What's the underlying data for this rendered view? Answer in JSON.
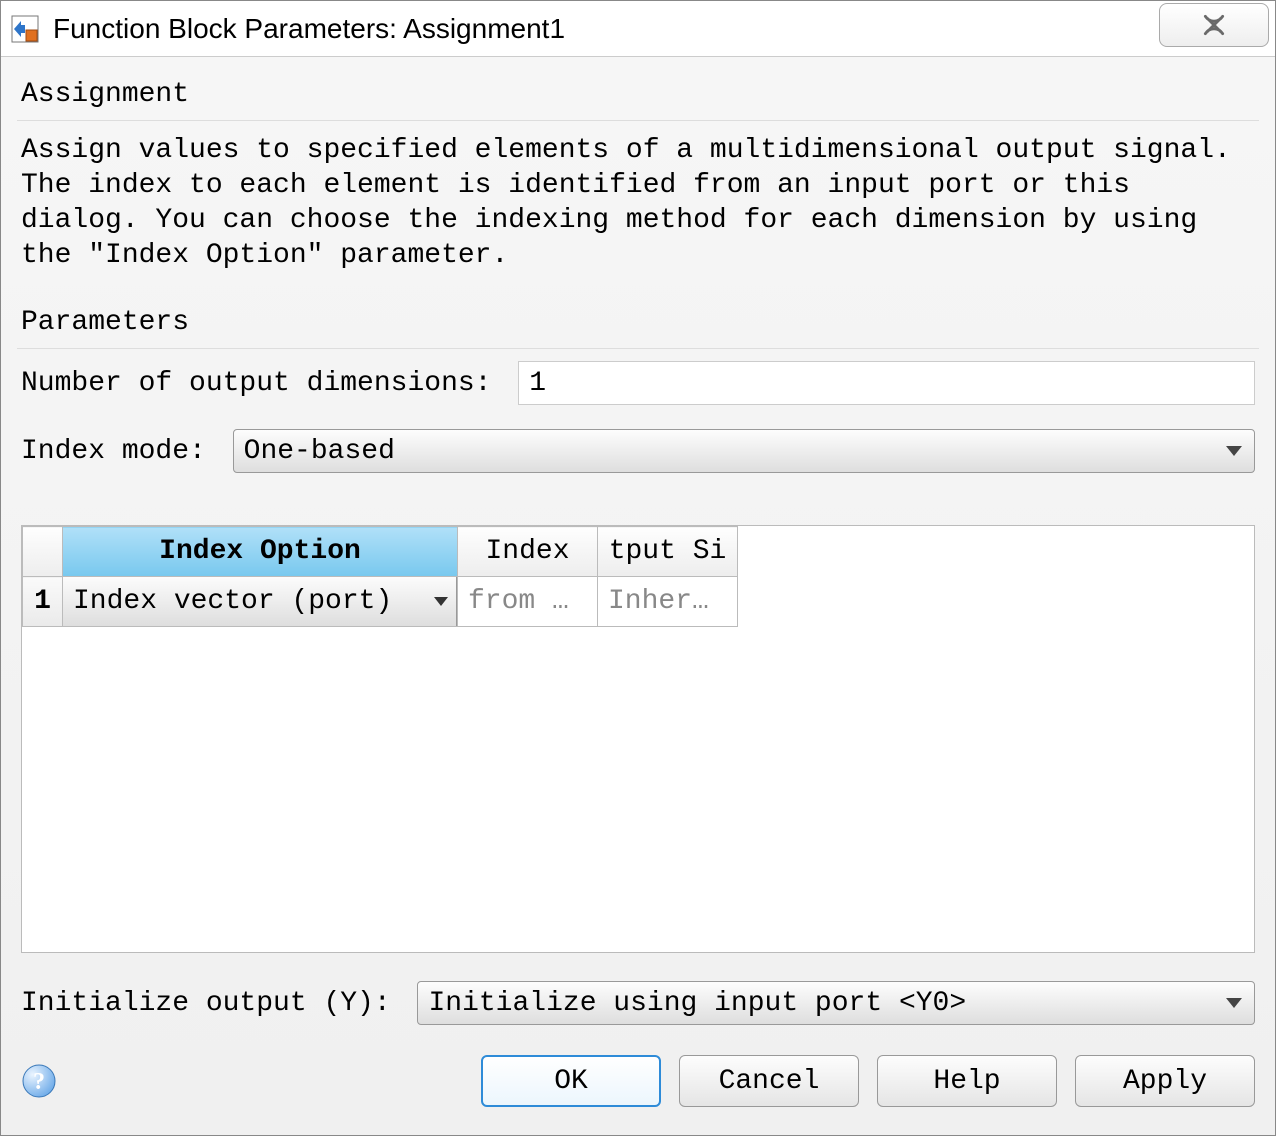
{
  "window": {
    "title": "Function Block Parameters: Assignment1"
  },
  "section1": {
    "header": "Assignment",
    "description": "Assign values to specified elements of a multidimensional output signal. The index to each element is identified from an input port or this dialog. You can choose the indexing method for each dimension by using the \"Index Option\" parameter."
  },
  "section2": {
    "header": "Parameters",
    "num_dims_label": "Number of output dimensions: ",
    "num_dims_value": "1",
    "index_mode_label": "Index mode: ",
    "index_mode_value": "One-based"
  },
  "table": {
    "columns": [
      "",
      "Index Option",
      "Index",
      "tput Si"
    ],
    "rows": [
      {
        "num": "1",
        "option": "Index vector (port)",
        "index": "from …",
        "output_size": "Inher…"
      }
    ]
  },
  "init_output": {
    "label": "Initialize output (Y): ",
    "value": "Initialize using input port <Y0>"
  },
  "buttons": {
    "ok": "OK",
    "cancel": "Cancel",
    "help": "Help",
    "apply": "Apply"
  }
}
